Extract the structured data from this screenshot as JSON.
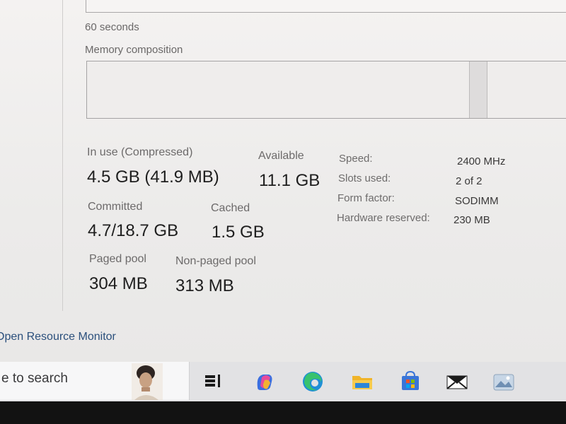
{
  "cpu_graph": {
    "time_label": "60 seconds"
  },
  "memory": {
    "composition_label": "Memory composition",
    "in_use_label": "In use (Compressed)",
    "in_use_value": "4.5 GB (41.9 MB)",
    "available_label": "Available",
    "available_value": "11.1 GB",
    "committed_label": "Committed",
    "committed_value": "4.7/18.7 GB",
    "cached_label": "Cached",
    "cached_value": "1.5 GB",
    "paged_pool_label": "Paged pool",
    "paged_pool_value": "304 MB",
    "non_paged_pool_label": "Non-paged pool",
    "non_paged_pool_value": "313 MB"
  },
  "specs": {
    "speed_label": "Speed:",
    "speed_value": "2400 MHz",
    "slots_label": "Slots used:",
    "slots_value": "2 of 2",
    "form_label": "Form factor:",
    "form_value": "SODIMM",
    "hw_reserved_label": "Hardware reserved:",
    "hw_reserved_value": "230 MB"
  },
  "footer": {
    "open_resource_monitor": "Open Resource Monitor"
  },
  "taskbar": {
    "search_text": "e to search",
    "icons": [
      "task-view-icon",
      "copilot-icon",
      "edge-icon",
      "file-explorer-icon",
      "microsoft-store-icon",
      "mail-icon",
      "photos-icon"
    ]
  }
}
